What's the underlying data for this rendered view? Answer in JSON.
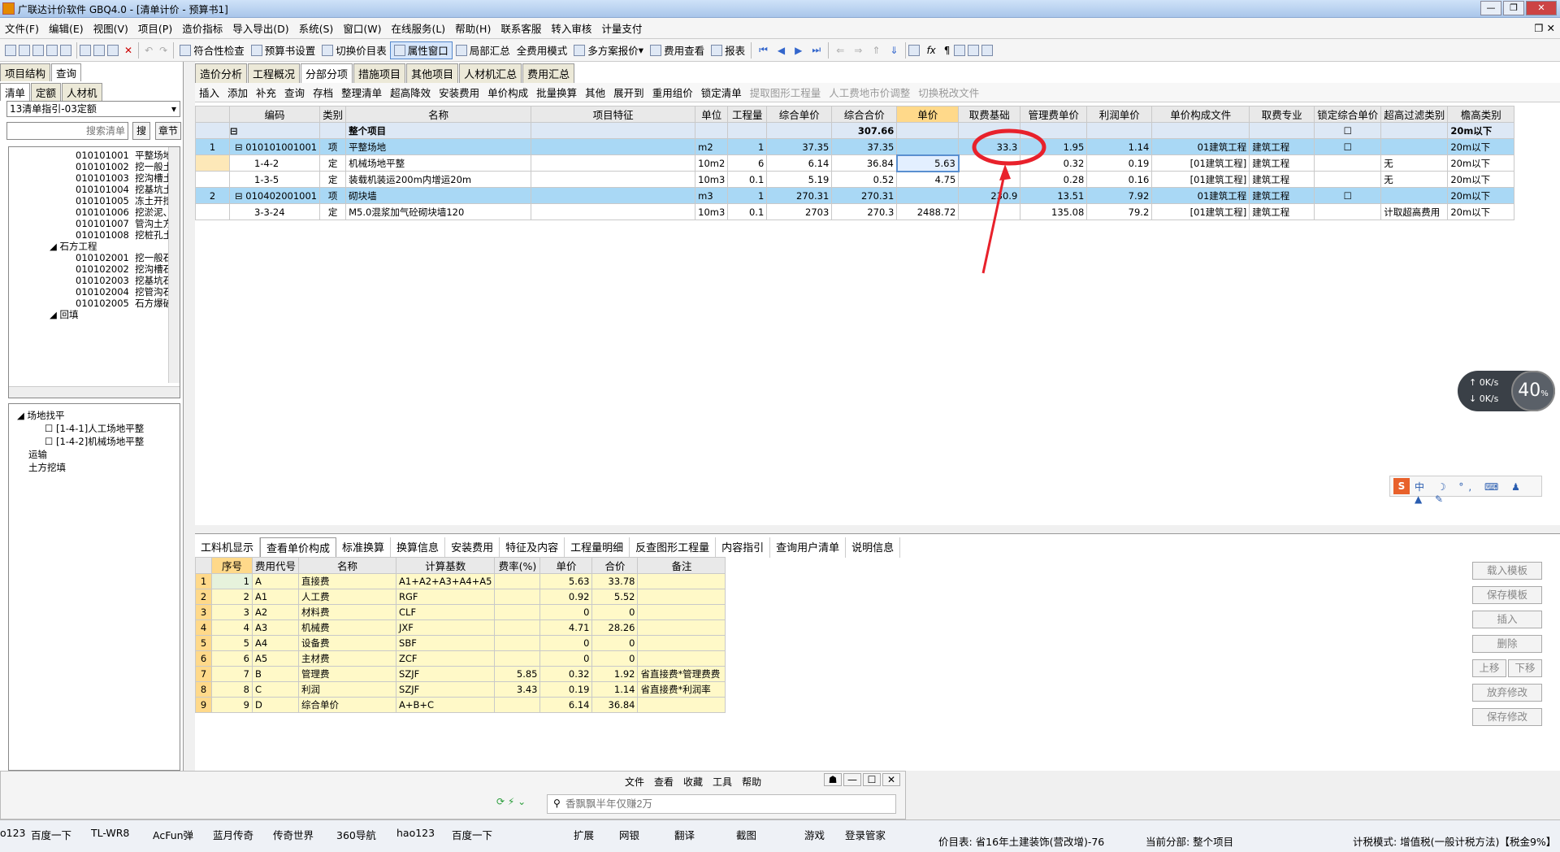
{
  "window": {
    "title": "广联达计价软件 GBQ4.0 - [清单计价 - 预算书1]"
  },
  "menu": [
    "文件(F)",
    "编辑(E)",
    "视图(V)",
    "项目(P)",
    "造价指标",
    "导入导出(D)",
    "系统(S)",
    "窗口(W)",
    "在线服务(L)",
    "帮助(H)",
    "联系客服",
    "转入审核",
    "计量支付"
  ],
  "toolbar": [
    "符合性检查",
    "预算书设置",
    "切换价目表",
    "属性窗口",
    "局部汇总",
    "全费用模式",
    "多方案报价",
    "费用查看",
    "报表"
  ],
  "left": {
    "tabs": [
      "项目结构",
      "查询"
    ],
    "subtabs": [
      "清单",
      "定额",
      "人材机"
    ],
    "select_value": "13清单指引-03定额",
    "search_placeholder": "搜索清单",
    "btn_search": "搜",
    "btn_chapter": "章节",
    "tree": [
      {
        "code": "010101001",
        "name": "平整场地"
      },
      {
        "code": "010101002",
        "name": "挖一般土"
      },
      {
        "code": "010101003",
        "name": "挖沟槽土"
      },
      {
        "code": "010101004",
        "name": "挖基坑土"
      },
      {
        "code": "010101005",
        "name": "冻土开挖"
      },
      {
        "code": "010101006",
        "name": "挖淤泥、"
      },
      {
        "code": "010101007",
        "name": "管沟土方"
      },
      {
        "code": "010101008",
        "name": "挖桩孔土"
      },
      {
        "code": "",
        "name": "石方工程"
      },
      {
        "code": "010102001",
        "name": "挖一般石"
      },
      {
        "code": "010102002",
        "name": "挖沟槽石"
      },
      {
        "code": "010102003",
        "name": "挖基坑石"
      },
      {
        "code": "010102004",
        "name": "挖管沟石"
      },
      {
        "code": "010102005",
        "name": "石方爆破"
      },
      {
        "code": "",
        "name": "回填"
      }
    ],
    "tree2": [
      "场地找平",
      "[1-4-1]人工场地平整",
      "[1-4-2]机械场地平整",
      "运输",
      "土方挖填"
    ]
  },
  "main": {
    "tabs": [
      "造价分析",
      "工程概况",
      "分部分项",
      "措施项目",
      "其他项目",
      "人材机汇总",
      "费用汇总"
    ],
    "subtoolbar": [
      "插入",
      "添加",
      "补充",
      "查询",
      "存档",
      "整理清单",
      "超高降效",
      "安装费用",
      "单价构成",
      "批量换算",
      "其他",
      "展开到",
      "重用组价",
      "锁定清单",
      "提取图形工程量",
      "人工费地市价调整",
      "切换税改文件"
    ],
    "columns": [
      "",
      "编码",
      "类别",
      "名称",
      "项目特征",
      "单位",
      "工程量",
      "综合单价",
      "综合合价",
      "单价",
      "取费基础",
      "管理费单价",
      "利润单价",
      "单价构成文件",
      "取费专业",
      "锁定综合单价",
      "超高过滤类别",
      "檐高类别"
    ],
    "rows": [
      {
        "type": "total",
        "no": "",
        "code": "",
        "cat": "",
        "name": "整个项目",
        "feat": "",
        "unit": "",
        "qty": "",
        "uprice": "",
        "total": "307.66",
        "price": "",
        "base": "",
        "mgmt": "",
        "profit": "",
        "file": "",
        "spec": "",
        "lock": "",
        "filt": "",
        "height": "20m以下"
      },
      {
        "type": "lvl1",
        "no": "1",
        "code": "010101001001",
        "cat": "项",
        "name": "平整场地",
        "feat": "",
        "unit": "m2",
        "qty": "1",
        "uprice": "37.35",
        "total": "37.35",
        "price": "",
        "base": "33.3",
        "mgmt": "1.95",
        "profit": "1.14",
        "file": "01建筑工程",
        "spec": "建筑工程",
        "lock": "",
        "filt": "",
        "height": "20m以下"
      },
      {
        "type": "sub",
        "no": "",
        "code": "1-4-2",
        "cat": "定",
        "name": "机械场地平整",
        "feat": "",
        "unit": "10m2",
        "qty": "6",
        "uprice": "6.14",
        "total": "36.84",
        "price": "5.63",
        "base": "",
        "mgmt": "0.32",
        "profit": "0.19",
        "file": "[01建筑工程]",
        "spec": "建筑工程",
        "lock": "",
        "filt": "无",
        "height": "20m以下"
      },
      {
        "type": "sub",
        "no": "",
        "code": "1-3-5",
        "cat": "定",
        "name": "装载机装运200m内增运20m",
        "feat": "",
        "unit": "10m3",
        "qty": "0.1",
        "uprice": "5.19",
        "total": "0.52",
        "price": "4.75",
        "base": "",
        "mgmt": "0.28",
        "profit": "0.16",
        "file": "[01建筑工程]",
        "spec": "建筑工程",
        "lock": "",
        "filt": "无",
        "height": "20m以下"
      },
      {
        "type": "lvl1",
        "no": "2",
        "code": "010402001001",
        "cat": "项",
        "name": "砌块墙",
        "feat": "",
        "unit": "m3",
        "qty": "1",
        "uprice": "270.31",
        "total": "270.31",
        "price": "",
        "base": "230.9",
        "mgmt": "13.51",
        "profit": "7.92",
        "file": "01建筑工程",
        "spec": "建筑工程",
        "lock": "",
        "filt": "",
        "height": "20m以下"
      },
      {
        "type": "sub",
        "no": "",
        "code": "3-3-24",
        "cat": "定",
        "name": "M5.0混浆加气砼砌块墙120",
        "feat": "",
        "unit": "10m3",
        "qty": "0.1",
        "uprice": "2703",
        "total": "270.3",
        "price": "2488.72",
        "base": "",
        "mgmt": "135.08",
        "profit": "79.2",
        "file": "[01建筑工程]",
        "spec": "建筑工程",
        "lock": "",
        "filt": "计取超高费用",
        "height": "20m以下"
      }
    ]
  },
  "bottom": {
    "tabs": [
      "工料机显示",
      "查看单价构成",
      "标准换算",
      "换算信息",
      "安装费用",
      "特征及内容",
      "工程量明细",
      "反查图形工程量",
      "内容指引",
      "查询用户清单",
      "说明信息"
    ],
    "columns": [
      "",
      "序号",
      "费用代号",
      "名称",
      "计算基数",
      "费率(%)",
      "单价",
      "合价",
      "备注"
    ],
    "rows": [
      [
        "1",
        "1",
        "A",
        "直接费",
        "A1+A2+A3+A4+A5",
        "",
        "5.63",
        "33.78",
        ""
      ],
      [
        "2",
        "2",
        "A1",
        "人工费",
        "RGF",
        "",
        "0.92",
        "5.52",
        ""
      ],
      [
        "3",
        "3",
        "A2",
        "材料费",
        "CLF",
        "",
        "0",
        "0",
        ""
      ],
      [
        "4",
        "4",
        "A3",
        "机械费",
        "JXF",
        "",
        "4.71",
        "28.26",
        ""
      ],
      [
        "5",
        "5",
        "A4",
        "设备费",
        "SBF",
        "",
        "0",
        "0",
        ""
      ],
      [
        "6",
        "6",
        "A5",
        "主材费",
        "ZCF",
        "",
        "0",
        "0",
        ""
      ],
      [
        "7",
        "7",
        "B",
        "管理费",
        "SZJF",
        "5.85",
        "0.32",
        "1.92",
        "省直接费*管理费费"
      ],
      [
        "8",
        "8",
        "C",
        "利润",
        "SZJF",
        "3.43",
        "0.19",
        "1.14",
        "省直接费*利润率"
      ],
      [
        "9",
        "9",
        "D",
        "综合单价",
        "A+B+C",
        "",
        "6.14",
        "36.84",
        ""
      ]
    ],
    "buttons": [
      "载入模板",
      "保存模板",
      "插入",
      "删除",
      "上移",
      "下移",
      "放弃修改",
      "保存修改"
    ]
  },
  "browser": {
    "menu": [
      "文件",
      "查看",
      "收藏",
      "工具",
      "帮助"
    ],
    "search_placeholder": "香飘飘半年仅赚2万",
    "bookmarks": [
      "o123",
      "百度一下",
      "TL-WR8",
      "AcFun弹",
      "蓝月传奇",
      "传奇世界",
      "360导航",
      "hao123",
      "百度一下"
    ],
    "tools": [
      "扩展",
      "网银",
      "翻译",
      "截图",
      "游戏",
      "登录管家"
    ]
  },
  "status": {
    "price_table": "价目表: 省16年土建装饰(营改增)-76",
    "current": "当前分部: 整个项目",
    "tax": "计税模式: 增值税(一般计税方法)【税金9%】"
  },
  "speed": {
    "up": "0K/s",
    "down": "0K/s",
    "pct": "40"
  },
  "colors": {
    "highlight": "#ffd98a",
    "row_blue": "#a9d8f5",
    "annotation": "#e8212b"
  }
}
